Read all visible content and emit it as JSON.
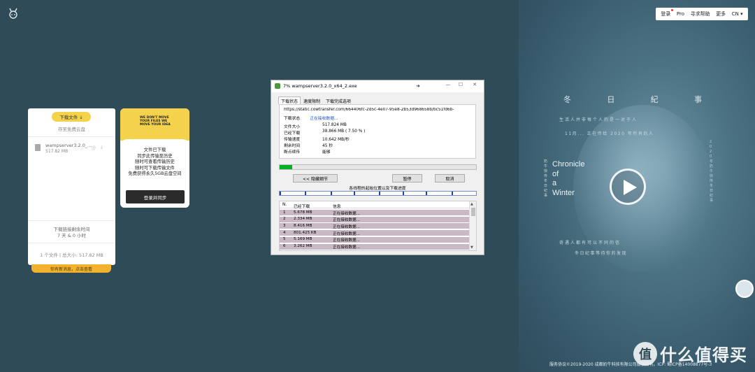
{
  "top_nav": {
    "login": "登录",
    "pro": "Pro",
    "help": "寻求帮助",
    "more": "更多",
    "lang": "CN"
  },
  "transfer_card": {
    "download_button": "下载文件 ↓",
    "save_text": "存至免费云盘",
    "file_name": "wampserver3.2.0_...",
    "file_size": "517.82 MB",
    "expire_label": "下载链接剩余时间",
    "expire_value": "7 天 & 0 小时",
    "summary": "1 个文件 | 总大小: 517.82 MB",
    "message_bar": "你有新消息，点击查看"
  },
  "ad_card": {
    "slogan": "WE DON'T MOVE YOUR FILES WE MOVE YOUR IDEA",
    "lines": [
      "文件已下载",
      "同步此传输至历史",
      "随时可查看传输历史",
      "随时可下载传输文件",
      "免费获得永久5GB云盘空间"
    ],
    "login_button": "登录并同步"
  },
  "download_window": {
    "title": "7% wampserver3.2.0_x64_2.exe",
    "tabs": [
      "下载状态",
      "速度限制",
      "下载完成选项"
    ],
    "url": "https://static.cowtransfer.com/664406fc-2d5c-4e07-95e8-2b53d968658b/bc51fd6b-",
    "status_label": "下载状态",
    "status_value": "正在接收数据...",
    "fields": [
      {
        "k": "文件大小",
        "v": "517.824  MB"
      },
      {
        "k": "已经下载",
        "v": "38.866  MB  ( 7.50 % )"
      },
      {
        "k": "传输速度",
        "v": "10.642  MB/秒"
      },
      {
        "k": "剩余时间",
        "v": "45 秒"
      },
      {
        "k": "断点续传",
        "v": "能够"
      }
    ],
    "progress_fraction": 0.065,
    "hide_details_button": "<< 隐藏细节",
    "pause_button": "暂停",
    "cancel_button": "取消",
    "segments_label": "各线程的起始位置以及下载进度",
    "segment_positions": [
      0.0,
      0.13,
      0.26,
      0.38,
      0.51,
      0.63,
      0.75,
      0.88
    ],
    "table_headers": [
      "N.",
      "已经下载",
      "信息"
    ],
    "rows": [
      {
        "n": "1",
        "downloaded": "5.678  MB",
        "info": "正在接收数据..."
      },
      {
        "n": "2",
        "downloaded": "2.334  MB",
        "info": "正在接收数据..."
      },
      {
        "n": "3",
        "downloaded": "8.416  MB",
        "info": "正在接收数据..."
      },
      {
        "n": "4",
        "downloaded": "801.425  KB",
        "info": "正在接收数据..."
      },
      {
        "n": "5",
        "downloaded": "5.169  MB",
        "info": "正在接收数据..."
      },
      {
        "n": "6",
        "downloaded": "3.262  MB",
        "info": "正在接收数据..."
      }
    ]
  },
  "promo": {
    "title_chars": [
      "冬",
      "日",
      "紀",
      "事"
    ],
    "line1": "生活人并非每个人的是一对于人",
    "line2": "11月... 正在传给 2020 年所有的人",
    "chronicle": [
      "Chronicle",
      "of",
      "a",
      "Winter"
    ],
    "vertical_left": "奶牛快传冬日纪事",
    "line3": "奇遇人都有可以不同的信",
    "line4": "冬日纪事等待你的发现",
    "vertical_right": "2020年奶牛快传冬日纪事",
    "footer": "服务协议©2019-2020 成都奶牛科技有限公司版权所有。ICP: 蜀ICP备14008877号-3",
    "watermark_mark": "值",
    "watermark_text": "什么值得买"
  }
}
